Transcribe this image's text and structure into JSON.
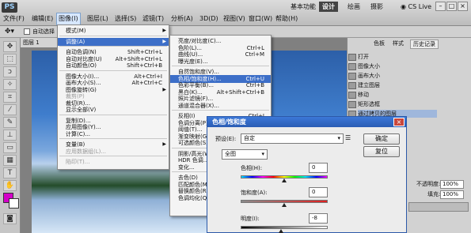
{
  "app": {
    "logo": "PS",
    "title_hidden": ""
  },
  "menubar": {
    "items": [
      "文件(F)",
      "编辑(E)",
      "图像(I)",
      "图层(L)",
      "选择(S)",
      "滤镜(T)",
      "分析(A)",
      "3D(D)",
      "视图(V)",
      "窗口(W)",
      "帮助(H)"
    ],
    "active_index": 2,
    "workspaces": [
      "基本功能",
      "设计",
      "绘画",
      "摄影"
    ],
    "selected_workspace_index": 1,
    "cs_live": "CS Live",
    "window_controls": [
      "–",
      "□",
      "×"
    ]
  },
  "options_bar": {
    "auto_select": "自动选择"
  },
  "doc_tab": "图层 1",
  "image_menu": {
    "items": [
      {
        "label": "模式(M)",
        "shortcut": "",
        "disabled": false,
        "submenu": true
      },
      {
        "sep": true
      },
      {
        "label": "调整(A)",
        "shortcut": "",
        "disabled": false,
        "submenu": true,
        "highlighted": true
      },
      {
        "sep": true
      },
      {
        "label": "自动色调(N)",
        "shortcut": "Shift+Ctrl+L"
      },
      {
        "label": "自动对比度(U)",
        "shortcut": "Alt+Shift+Ctrl+L"
      },
      {
        "label": "自动颜色(O)",
        "shortcut": "Shift+Ctrl+B"
      },
      {
        "sep": true
      },
      {
        "label": "图像大小(I)...",
        "shortcut": "Alt+Ctrl+I"
      },
      {
        "label": "画布大小(S)...",
        "shortcut": "Alt+Ctrl+C"
      },
      {
        "label": "图像旋转(G)",
        "shortcut": "",
        "submenu": true
      },
      {
        "label": "裁剪(P)",
        "shortcut": "",
        "disabled": true
      },
      {
        "label": "裁切(R)...",
        "shortcut": ""
      },
      {
        "label": "显示全部(V)",
        "shortcut": ""
      },
      {
        "sep": true
      },
      {
        "label": "复制(D)...",
        "shortcut": ""
      },
      {
        "label": "应用图像(Y)...",
        "shortcut": ""
      },
      {
        "label": "计算(C)...",
        "shortcut": ""
      },
      {
        "sep": true
      },
      {
        "label": "变量(B)",
        "shortcut": "",
        "submenu": true
      },
      {
        "label": "应用数据组(L)...",
        "shortcut": "",
        "disabled": true
      },
      {
        "sep": true
      },
      {
        "label": "陷印(T)...",
        "shortcut": "",
        "disabled": true
      }
    ]
  },
  "adjust_menu": {
    "items": [
      {
        "label": "亮度/对比度(C)...",
        "shortcut": ""
      },
      {
        "label": "色阶(L)...",
        "shortcut": "Ctrl+L"
      },
      {
        "label": "曲线(U)...",
        "shortcut": "Ctrl+M"
      },
      {
        "label": "曝光度(E)...",
        "shortcut": ""
      },
      {
        "sep": true
      },
      {
        "label": "自然饱和度(V)...",
        "shortcut": ""
      },
      {
        "label": "色相/饱和度(H)...",
        "shortcut": "Ctrl+U",
        "highlighted": true
      },
      {
        "label": "色彩平衡(B)...",
        "shortcut": "Ctrl+B"
      },
      {
        "label": "黑白(K)...",
        "shortcut": "Alt+Shift+Ctrl+B"
      },
      {
        "label": "照片滤镜(F)...",
        "shortcut": ""
      },
      {
        "label": "通道混合器(X)...",
        "shortcut": ""
      },
      {
        "sep": true
      },
      {
        "label": "反相(I)",
        "shortcut": "Ctrl+I"
      },
      {
        "label": "色调分离(P)...",
        "shortcut": ""
      },
      {
        "label": "阈值(T)...",
        "shortcut": ""
      },
      {
        "label": "渐变映射(G)...",
        "shortcut": ""
      },
      {
        "label": "可选颜色(S)...",
        "shortcut": ""
      },
      {
        "sep": true
      },
      {
        "label": "阴影/高光(W)...",
        "shortcut": ""
      },
      {
        "label": "HDR 色调...",
        "shortcut": ""
      },
      {
        "label": "变化...",
        "shortcut": ""
      },
      {
        "sep": true
      },
      {
        "label": "去色(D)",
        "shortcut": "Shift+Ctrl+U"
      },
      {
        "label": "匹配颜色(M)...",
        "shortcut": ""
      },
      {
        "label": "替换颜色(R)...",
        "shortcut": ""
      },
      {
        "label": "色调均化(Q)",
        "shortcut": ""
      }
    ]
  },
  "right_panel": {
    "tabs": [
      "色板",
      "样式",
      "历史记录"
    ],
    "history": [
      "打开",
      "图像大小",
      "画布大小",
      "建立图层",
      "移动",
      "矩形选框",
      "通过拷贝的图层"
    ],
    "opacity_label": "不透明度:",
    "opacity_value": "100%",
    "fill_label": "填充:",
    "fill_value": "100%"
  },
  "dialog": {
    "title": "色相/饱和度",
    "close": "×",
    "preset_label": "预设(E):",
    "preset_value": "自定",
    "channel_value": "全图",
    "hue_label": "色相(H):",
    "hue_value": "0",
    "sat_label": "饱和度(A):",
    "sat_value": "0",
    "light_label": "明度(I):",
    "light_value": "-8",
    "ok_label": "确定",
    "reset_label": "复位"
  },
  "colors": {
    "foreground": "#d400c8",
    "background": "#ffffff",
    "highlight": "#3d6fc8",
    "dialog_title": "#2a5cb4"
  },
  "icons": [
    "move-icon",
    "marquee-icon",
    "lasso-icon",
    "magic-wand-icon",
    "crop-icon",
    "eyedropper-icon",
    "brush-icon",
    "stamp-icon",
    "history-brush-icon",
    "eraser-icon",
    "gradient-icon",
    "blur-icon",
    "dodge-icon",
    "pen-icon",
    "text-icon",
    "path-select-icon",
    "shape-icon",
    "hand-icon",
    "zoom-icon"
  ]
}
